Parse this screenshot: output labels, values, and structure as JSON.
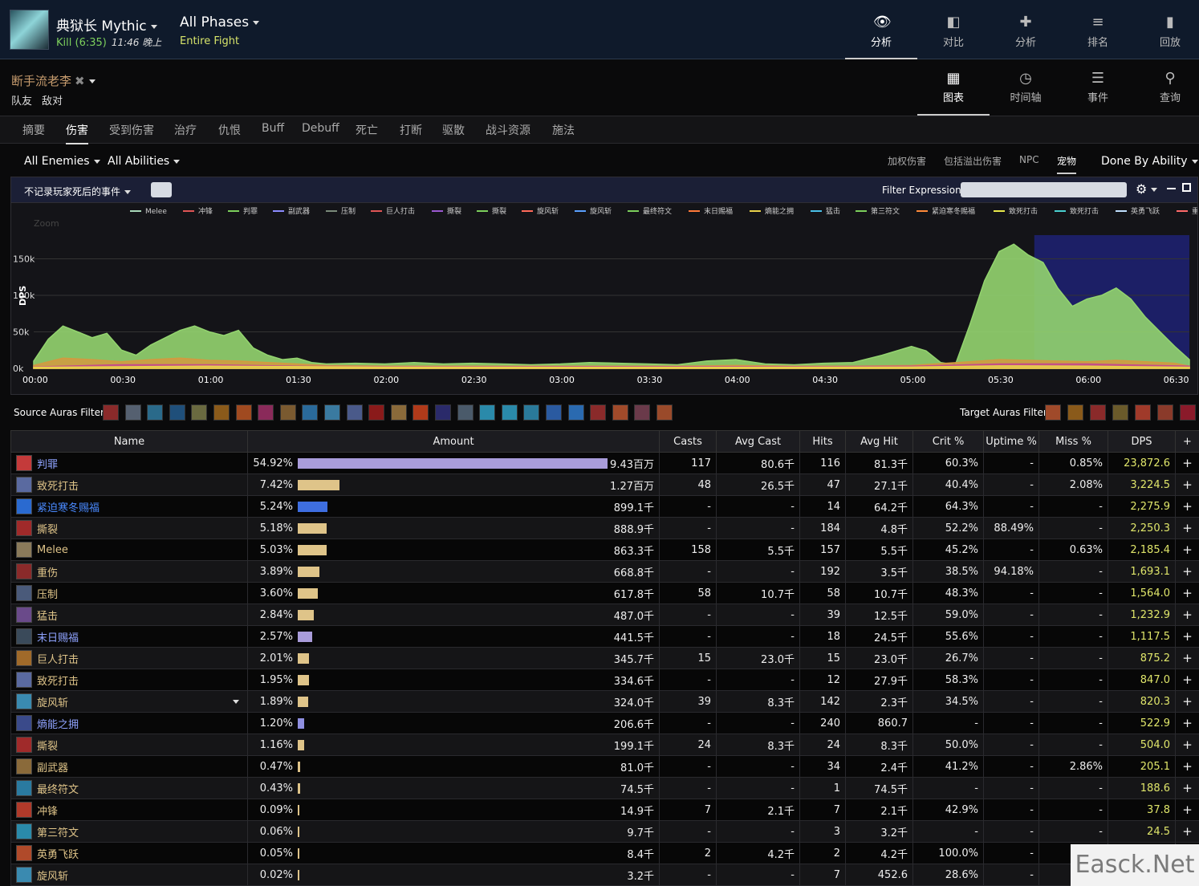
{
  "header": {
    "boss_name": "典狱长 Mythic",
    "kill_text": "Kill (6:35)",
    "kill_time": "11:46 晚上",
    "phase_title": "All Phases",
    "phase_sub": "Entire Fight",
    "nav": [
      {
        "label": "分析",
        "icon": "eye-icon"
      },
      {
        "label": "对比",
        "icon": "compare-icon"
      },
      {
        "label": "分析",
        "icon": "puzzle-icon"
      },
      {
        "label": "排名",
        "icon": "ranking-icon"
      },
      {
        "label": "回放",
        "icon": "replay-icon"
      }
    ]
  },
  "player": {
    "name": "断手流老李",
    "close_glyph": "✖",
    "sub": [
      "队友",
      "敌对"
    ],
    "nav": [
      {
        "label": "图表",
        "icon": "grid-icon"
      },
      {
        "label": "时间轴",
        "icon": "clock-icon"
      },
      {
        "label": "事件",
        "icon": "list-icon"
      },
      {
        "label": "查询",
        "icon": "pin-icon"
      }
    ]
  },
  "tabs": [
    "摘要",
    "伤害",
    "受到伤害",
    "治疗",
    "仇恨",
    "Buff",
    "Debuff",
    "死亡",
    "打断",
    "驱散",
    "战斗资源",
    "施法"
  ],
  "filters": {
    "enemies": "All Enemies",
    "abilities": "All Abilities",
    "options": [
      "加权伤害",
      "包括溢出伤害",
      "NPC",
      "宠物"
    ],
    "done_by": "Done By Ability"
  },
  "graph": {
    "death_filter": "不记录玩家死后的事件",
    "filter_label": "Filter Expression:"
  },
  "chart_data": {
    "type": "area",
    "ylabel": "DPS",
    "zoom_label": "Zoom",
    "y_ticks": [
      "0k",
      "50k",
      "100k",
      "150k"
    ],
    "ylim": [
      0,
      200000
    ],
    "x_ticks": [
      "00:00",
      "00:30",
      "01:00",
      "01:30",
      "02:00",
      "02:30",
      "03:00",
      "03:30",
      "04:00",
      "04:30",
      "05:00",
      "05:30",
      "06:00",
      "06:30"
    ],
    "xlim": [
      0,
      395
    ],
    "legend": [
      {
        "name": "Melee",
        "color": "#a8d8b9"
      },
      {
        "name": "冲锋",
        "color": "#e05555"
      },
      {
        "name": "判罪",
        "color": "#7ccf5c"
      },
      {
        "name": "副武器",
        "color": "#8c8cff"
      },
      {
        "name": "压制",
        "color": "#7a8a7a"
      },
      {
        "name": "巨人打击",
        "color": "#e05555"
      },
      {
        "name": "撕裂",
        "color": "#9b59d0"
      },
      {
        "name": "撕裂",
        "color": "#7ccf5c"
      },
      {
        "name": "旋风斩",
        "color": "#ff6a5a"
      },
      {
        "name": "旋风斩",
        "color": "#5aa0ff"
      },
      {
        "name": "最终符文",
        "color": "#7ccf5c"
      },
      {
        "name": "末日赐福",
        "color": "#ff7a3a"
      },
      {
        "name": "熵能之拥",
        "color": "#e8d24a"
      },
      {
        "name": "猛击",
        "color": "#4ac0e8"
      },
      {
        "name": "第三符文",
        "color": "#7ccf5c"
      },
      {
        "name": "紧迫寒冬赐福",
        "color": "#ff8a3a"
      },
      {
        "name": "致死打击",
        "color": "#e8e84a"
      },
      {
        "name": "致死打击",
        "color": "#4ad0d0"
      },
      {
        "name": "英勇飞跃",
        "color": "#c0e0ff"
      },
      {
        "name": "重伤",
        "color": "#ff6a6a"
      }
    ],
    "series": [
      {
        "name": "判罪",
        "color": "#93d46f",
        "x": [
          0,
          5,
          10,
          15,
          20,
          25,
          30,
          35,
          40,
          45,
          50,
          55,
          60,
          65,
          70,
          75,
          80,
          85,
          90,
          95,
          100,
          110,
          120,
          130,
          140,
          150,
          160,
          170,
          180,
          190,
          200,
          210,
          220,
          230,
          240,
          250,
          260,
          270,
          280,
          290,
          300,
          305,
          310,
          315,
          320,
          325,
          330,
          335,
          340,
          345,
          350,
          355,
          360,
          365,
          370,
          375,
          380,
          385,
          390,
          395
        ],
        "values": [
          10000,
          40000,
          58000,
          50000,
          42000,
          48000,
          25000,
          18000,
          32000,
          42000,
          52000,
          58000,
          50000,
          45000,
          52000,
          28000,
          18000,
          12000,
          14000,
          8000,
          6000,
          7000,
          6000,
          8000,
          6000,
          7000,
          6000,
          5000,
          6000,
          8000,
          7000,
          6000,
          5000,
          10000,
          12000,
          6000,
          5000,
          7000,
          8000,
          18000,
          30000,
          24000,
          8000,
          5000,
          60000,
          120000,
          160000,
          170000,
          155000,
          145000,
          110000,
          85000,
          95000,
          100000,
          110000,
          95000,
          70000,
          50000,
          30000,
          12000
        ]
      },
      {
        "name": "致死打击",
        "color": "#d39a40",
        "x": [
          0,
          10,
          20,
          30,
          40,
          50,
          60,
          70,
          80,
          90,
          100,
          120,
          140,
          160,
          180,
          200,
          220,
          240,
          260,
          280,
          300,
          320,
          330,
          340,
          350,
          360,
          370,
          380,
          390,
          395
        ],
        "values": [
          4000,
          14000,
          12000,
          9000,
          12000,
          14000,
          11000,
          10000,
          8000,
          6000,
          4000,
          3000,
          3000,
          3000,
          3000,
          3000,
          3000,
          4000,
          3000,
          3000,
          4000,
          9000,
          12000,
          11000,
          10000,
          9000,
          11000,
          9000,
          7000,
          3000
        ]
      },
      {
        "name": "撕裂",
        "color": "#c44b8a",
        "x": [
          0,
          30,
          60,
          90,
          120,
          150,
          180,
          210,
          240,
          270,
          300,
          330,
          360,
          395
        ],
        "values": [
          2000,
          5000,
          5000,
          3000,
          2500,
          2500,
          2500,
          2500,
          2500,
          2500,
          3000,
          6000,
          6000,
          3000
        ]
      },
      {
        "name": "熵能之拥",
        "color": "#e8d24a",
        "x": [
          0,
          60,
          120,
          180,
          240,
          300,
          330,
          360,
          395
        ],
        "values": [
          1500,
          3000,
          1800,
          1500,
          1500,
          1800,
          3500,
          3000,
          1500
        ]
      }
    ],
    "highlight_range": [
      342,
      395
    ]
  },
  "auras": {
    "source_label": "Source Auras Filter:",
    "target_label": "Target Auras Filter:",
    "source_colors": [
      "#8a2a2a",
      "#556070",
      "#2a6a8a",
      "#1f4f7a",
      "#6a6a40",
      "#8a5a1a",
      "#a04a20",
      "#8a2a5a",
      "#7a5a30",
      "#2a6a9a",
      "#3a7aa0",
      "#4a5a8a",
      "#8a1a1a",
      "#8a6a3a",
      "#b03a1a",
      "#2a2a6a",
      "#4a5a6a",
      "#2a8aaa",
      "#2a8aaa",
      "#2a7a9a",
      "#2a5aa0",
      "#2a6ab0",
      "#8a2a2a",
      "#a04a2a",
      "#6a3a4a",
      "#9a4a2a"
    ],
    "target_colors": [
      "#a04a2a",
      "#8a5a1a",
      "#8a2a2a",
      "#6a5a2a",
      "#a03a2a",
      "#8a3a2a",
      "#8a1a2a"
    ]
  },
  "table": {
    "headers": [
      "Name",
      "Amount",
      "Casts",
      "Avg Cast",
      "Hits",
      "Avg Hit",
      "Crit %",
      "Uptime %",
      "Miss %",
      "DPS",
      "+"
    ],
    "rows": [
      {
        "name": "判罪",
        "name_color": "#8fa3ff",
        "icon_color": "#c43a3a",
        "pct": "54.92%",
        "bar_fraction": 1.0,
        "bar_color": "#a99cda",
        "amount": "9.43百万",
        "casts": "117",
        "avg_cast": "80.6千",
        "hits": "116",
        "avg_hit": "81.3千",
        "crit": "60.3%",
        "uptime": "-",
        "miss": "0.85%",
        "dps": "23,872.6"
      },
      {
        "name": "致死打击",
        "name_color": "#dfc489",
        "icon_color": "#5a6aa0",
        "pct": "7.42%",
        "bar_fraction": 0.135,
        "bar_color": "#dfc489",
        "amount": "1.27百万",
        "casts": "48",
        "avg_cast": "26.5千",
        "hits": "47",
        "avg_hit": "27.1千",
        "crit": "40.4%",
        "uptime": "-",
        "miss": "2.08%",
        "dps": "3,224.5"
      },
      {
        "name": "紧迫寒冬赐福",
        "name_color": "#4a8aff",
        "icon_color": "#2a6ad0",
        "pct": "5.24%",
        "bar_fraction": 0.095,
        "bar_color": "#3e6ee0",
        "amount": "899.1千",
        "casts": "-",
        "avg_cast": "-",
        "hits": "14",
        "avg_hit": "64.2千",
        "crit": "64.3%",
        "uptime": "-",
        "miss": "-",
        "dps": "2,275.9"
      },
      {
        "name": "撕裂",
        "name_color": "#dfc489",
        "icon_color": "#a02a2a",
        "pct": "5.18%",
        "bar_fraction": 0.094,
        "bar_color": "#dfc489",
        "amount": "888.9千",
        "casts": "-",
        "avg_cast": "-",
        "hits": "184",
        "avg_hit": "4.8千",
        "crit": "52.2%",
        "uptime": "88.49%",
        "miss": "-",
        "dps": "2,250.3"
      },
      {
        "name": "Melee",
        "name_color": "#dfc489",
        "icon_color": "#8a7a5a",
        "pct": "5.03%",
        "bar_fraction": 0.092,
        "bar_color": "#dfc489",
        "amount": "863.3千",
        "casts": "158",
        "avg_cast": "5.5千",
        "hits": "157",
        "avg_hit": "5.5千",
        "crit": "45.2%",
        "uptime": "-",
        "miss": "0.63%",
        "dps": "2,185.4"
      },
      {
        "name": "重伤",
        "name_color": "#dfc489",
        "icon_color": "#8a2a2a",
        "pct": "3.89%",
        "bar_fraction": 0.071,
        "bar_color": "#dfc489",
        "amount": "668.8千",
        "casts": "-",
        "avg_cast": "-",
        "hits": "192",
        "avg_hit": "3.5千",
        "crit": "38.5%",
        "uptime": "94.18%",
        "miss": "-",
        "dps": "1,693.1"
      },
      {
        "name": "压制",
        "name_color": "#dfc489",
        "icon_color": "#4a5a7a",
        "pct": "3.60%",
        "bar_fraction": 0.066,
        "bar_color": "#dfc489",
        "amount": "617.8千",
        "casts": "58",
        "avg_cast": "10.7千",
        "hits": "58",
        "avg_hit": "10.7千",
        "crit": "48.3%",
        "uptime": "-",
        "miss": "-",
        "dps": "1,564.0"
      },
      {
        "name": "猛击",
        "name_color": "#dfc489",
        "icon_color": "#6a4a8a",
        "pct": "2.84%",
        "bar_fraction": 0.052,
        "bar_color": "#dfc489",
        "amount": "487.0千",
        "casts": "-",
        "avg_cast": "-",
        "hits": "39",
        "avg_hit": "12.5千",
        "crit": "59.0%",
        "uptime": "-",
        "miss": "-",
        "dps": "1,232.9"
      },
      {
        "name": "末日赐福",
        "name_color": "#8fa3ff",
        "icon_color": "#3a4a5a",
        "pct": "2.57%",
        "bar_fraction": 0.047,
        "bar_color": "#a99cda",
        "amount": "441.5千",
        "casts": "-",
        "avg_cast": "-",
        "hits": "18",
        "avg_hit": "24.5千",
        "crit": "55.6%",
        "uptime": "-",
        "miss": "-",
        "dps": "1,117.5"
      },
      {
        "name": "巨人打击",
        "name_color": "#dfc489",
        "icon_color": "#a06a2a",
        "pct": "2.01%",
        "bar_fraction": 0.037,
        "bar_color": "#dfc489",
        "amount": "345.7千",
        "casts": "15",
        "avg_cast": "23.0千",
        "hits": "15",
        "avg_hit": "23.0千",
        "crit": "26.7%",
        "uptime": "-",
        "miss": "-",
        "dps": "875.2"
      },
      {
        "name": "致死打击",
        "name_color": "#dfc489",
        "icon_color": "#5a6aa0",
        "pct": "1.95%",
        "bar_fraction": 0.036,
        "bar_color": "#dfc489",
        "amount": "334.6千",
        "casts": "-",
        "avg_cast": "-",
        "hits": "12",
        "avg_hit": "27.9千",
        "crit": "58.3%",
        "uptime": "-",
        "miss": "-",
        "dps": "847.0"
      },
      {
        "name": "旋风斩",
        "name_color": "#dfc489",
        "icon_color": "#3a8ab0",
        "pct": "1.89%",
        "bar_fraction": 0.034,
        "bar_color": "#dfc489",
        "amount": "324.0千",
        "casts": "39",
        "avg_cast": "8.3千",
        "hits": "142",
        "avg_hit": "2.3千",
        "crit": "34.5%",
        "uptime": "-",
        "miss": "-",
        "dps": "820.3",
        "expand": true
      },
      {
        "name": "熵能之拥",
        "name_color": "#8fa3ff",
        "icon_color": "#3a4a8a",
        "pct": "1.20%",
        "bar_fraction": 0.022,
        "bar_color": "#8f8fe0",
        "amount": "206.6千",
        "casts": "-",
        "avg_cast": "-",
        "hits": "240",
        "avg_hit": "860.7",
        "crit": "-",
        "uptime": "-",
        "miss": "-",
        "dps": "522.9"
      },
      {
        "name": "撕裂",
        "name_color": "#dfc489",
        "icon_color": "#a02a2a",
        "pct": "1.16%",
        "bar_fraction": 0.021,
        "bar_color": "#dfc489",
        "amount": "199.1千",
        "casts": "24",
        "avg_cast": "8.3千",
        "hits": "24",
        "avg_hit": "8.3千",
        "crit": "50.0%",
        "uptime": "-",
        "miss": "-",
        "dps": "504.0"
      },
      {
        "name": "副武器",
        "name_color": "#dfc489",
        "icon_color": "#8a6a3a",
        "pct": "0.47%",
        "bar_fraction": 0.009,
        "bar_color": "#dfc489",
        "amount": "81.0千",
        "casts": "-",
        "avg_cast": "-",
        "hits": "34",
        "avg_hit": "2.4千",
        "crit": "41.2%",
        "uptime": "-",
        "miss": "2.86%",
        "dps": "205.1"
      },
      {
        "name": "最终符文",
        "name_color": "#dfc489",
        "icon_color": "#2a7aa0",
        "pct": "0.43%",
        "bar_fraction": 0.008,
        "bar_color": "#dfc489",
        "amount": "74.5千",
        "casts": "-",
        "avg_cast": "-",
        "hits": "1",
        "avg_hit": "74.5千",
        "crit": "-",
        "uptime": "-",
        "miss": "-",
        "dps": "188.6"
      },
      {
        "name": "冲锋",
        "name_color": "#dfc489",
        "icon_color": "#b03a2a",
        "pct": "0.09%",
        "bar_fraction": 0.002,
        "bar_color": "#dfc489",
        "amount": "14.9千",
        "casts": "7",
        "avg_cast": "2.1千",
        "hits": "7",
        "avg_hit": "2.1千",
        "crit": "42.9%",
        "uptime": "-",
        "miss": "-",
        "dps": "37.8"
      },
      {
        "name": "第三符文",
        "name_color": "#dfc489",
        "icon_color": "#2a8aaa",
        "pct": "0.06%",
        "bar_fraction": 0.001,
        "bar_color": "#dfc489",
        "amount": "9.7千",
        "casts": "-",
        "avg_cast": "-",
        "hits": "3",
        "avg_hit": "3.2千",
        "crit": "-",
        "uptime": "-",
        "miss": "-",
        "dps": "24.5"
      },
      {
        "name": "英勇飞跃",
        "name_color": "#dfc489",
        "icon_color": "#b04a2a",
        "pct": "0.05%",
        "bar_fraction": 0.001,
        "bar_color": "#dfc489",
        "amount": "8.4千",
        "casts": "2",
        "avg_cast": "4.2千",
        "hits": "2",
        "avg_hit": "4.2千",
        "crit": "100.0%",
        "uptime": "-",
        "miss": "-",
        "dps": ""
      },
      {
        "name": "旋风斩",
        "name_color": "#dfc489",
        "icon_color": "#3a8ab0",
        "pct": "0.02%",
        "bar_fraction": 0.0005,
        "bar_color": "#dfc489",
        "amount": "3.2千",
        "casts": "-",
        "avg_cast": "-",
        "hits": "7",
        "avg_hit": "452.6",
        "crit": "28.6%",
        "uptime": "-",
        "miss": "-",
        "dps": ""
      }
    ]
  },
  "watermark": "Easck.Net"
}
